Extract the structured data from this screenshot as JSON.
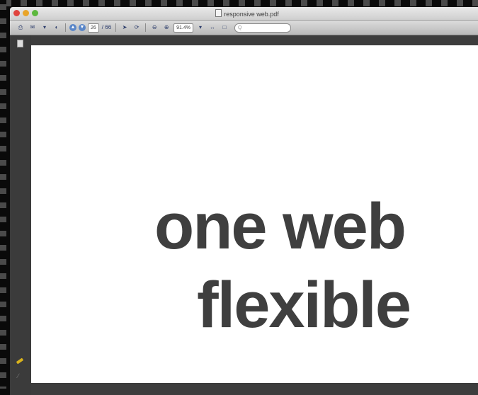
{
  "window": {
    "title": "responsive web.pdf"
  },
  "toolbar": {
    "page_current": "26",
    "page_total": "/ 66",
    "zoom": "91.4%",
    "search_placeholder": "Q"
  },
  "slide": {
    "line1": "one web",
    "line2": "flexible"
  },
  "icons": {
    "traffic_lights": [
      "close-icon",
      "minimize-icon",
      "zoom-icon"
    ],
    "rail": [
      "page-icon",
      "pencil-icon"
    ]
  },
  "colors": {
    "slide_text": "#3f3f3f",
    "window_chrome": "#3d3d3d",
    "close": "#e0443e",
    "minimize": "#e9a52a",
    "zoom": "#5cb83e"
  }
}
